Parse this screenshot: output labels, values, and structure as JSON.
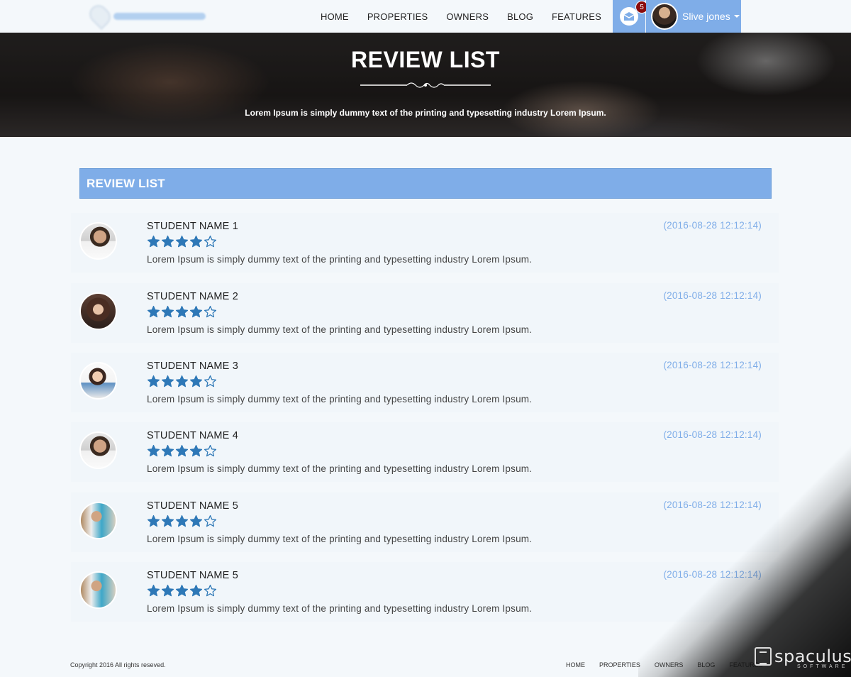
{
  "header": {
    "nav": [
      "HOME",
      "PROPERTIES",
      "OWNERS",
      "BLOG",
      "FEATURES"
    ],
    "mail_badge": "5",
    "user_name": "Slive jones"
  },
  "banner": {
    "title": "REVIEW LIST",
    "subtitle": "Lorem Ipsum is simply dummy text of the printing and typesetting industry Lorem Ipsum."
  },
  "section_title": "REVIEW LIST",
  "reviews": [
    {
      "name": "STUDENT NAME 1",
      "rating": 4,
      "max_rating": 5,
      "text": "Lorem Ipsum is simply dummy text of the printing and typesetting industry Lorem Ipsum.",
      "date": "(2016-08-28 12:12:14)"
    },
    {
      "name": "STUDENT NAME 2",
      "rating": 4,
      "max_rating": 5,
      "text": "Lorem Ipsum is simply dummy text of the printing and typesetting industry Lorem Ipsum.",
      "date": "(2016-08-28 12:12:14)"
    },
    {
      "name": "STUDENT NAME 3",
      "rating": 4,
      "max_rating": 5,
      "text": "Lorem Ipsum is simply dummy text of the printing and typesetting industry Lorem Ipsum.",
      "date": "(2016-08-28 12:12:14)"
    },
    {
      "name": "STUDENT NAME 4",
      "rating": 4,
      "max_rating": 5,
      "text": "Lorem Ipsum is simply dummy text of the printing and typesetting industry Lorem Ipsum.",
      "date": "(2016-08-28 12:12:14)"
    },
    {
      "name": "STUDENT NAME 5",
      "rating": 4,
      "max_rating": 5,
      "text": "Lorem Ipsum is simply dummy text of the printing and typesetting industry Lorem Ipsum.",
      "date": "(2016-08-28 12:12:14)"
    },
    {
      "name": "STUDENT NAME 5",
      "rating": 4,
      "max_rating": 5,
      "text": "Lorem Ipsum is simply dummy text of the printing and typesetting industry Lorem Ipsum.",
      "date": "(2016-08-28 12:12:14)"
    }
  ],
  "footer": {
    "copyright": "Copyright 2016 All rights reseved.",
    "nav": [
      "HOME",
      "PROPERTIES",
      "OWNERS",
      "BLOG",
      "FEATURES"
    ]
  },
  "watermark": {
    "brand": "spaculus",
    "sub": "SOFTWARE"
  },
  "colors": {
    "accent": "#7fade8",
    "star": "#2e78b7",
    "badge": "#8a0c0c"
  }
}
